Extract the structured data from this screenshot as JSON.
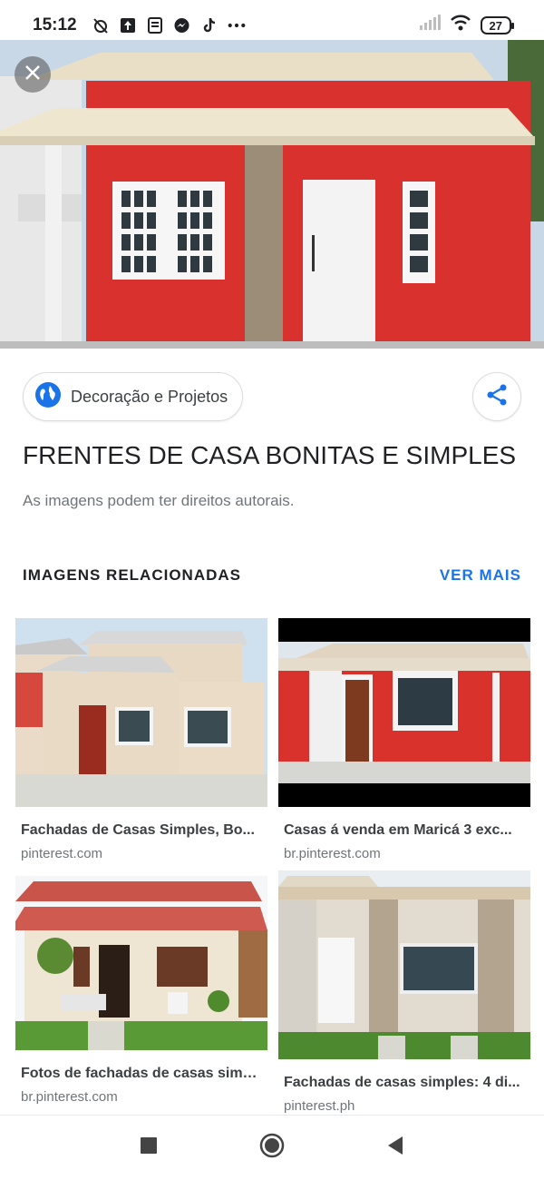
{
  "status": {
    "time": "15:12",
    "battery": "27"
  },
  "icons": {
    "close": "close-icon",
    "share": "share-icon",
    "globe": "globe-icon",
    "nav_recent": "recent-apps-icon",
    "nav_home": "home-icon",
    "nav_back": "back-icon"
  },
  "source": {
    "name": "Decoração e Projetos"
  },
  "image_title": "FRENTES DE CASA BONITAS E SIMPLES",
  "copyright_note": "As imagens podem ter direitos autorais.",
  "related": {
    "heading": "IMAGENS RELACIONADAS",
    "more": "VER MAIS",
    "items": [
      {
        "caption": "Fachadas de Casas Simples, Bo...",
        "domain": "pinterest.com"
      },
      {
        "caption": "Casas á venda em Maricá 3 exc...",
        "domain": "br.pinterest.com"
      },
      {
        "caption": "Fotos de fachadas de casas simp...",
        "domain": "br.pinterest.com"
      },
      {
        "caption": "Fachadas de casas simples: 4 di...",
        "domain": "pinterest.ph"
      }
    ]
  },
  "colors": {
    "accent": "#1a73e8",
    "house_red": "#d9312e"
  }
}
